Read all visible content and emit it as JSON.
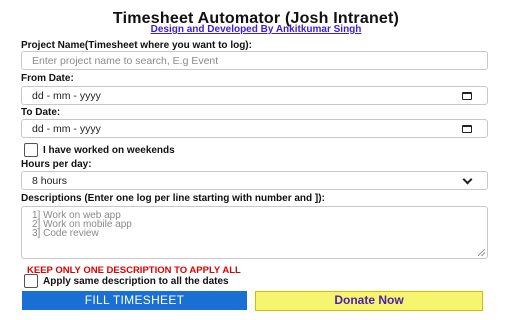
{
  "header": {
    "title": "Timesheet Automator (Josh Intranet)",
    "subtitle": "Design and Developed By Ankitkumar Singh"
  },
  "project": {
    "label": "Project Name(Timesheet where you want to log):",
    "placeholder": "Enter project name to search, E.g Event",
    "value": ""
  },
  "from_date": {
    "label": "From Date:",
    "placeholder": "dd - mm - yyyy",
    "icon": "calendar-icon"
  },
  "to_date": {
    "label": "To Date:",
    "placeholder": "dd - mm - yyyy",
    "icon": "calendar-icon"
  },
  "weekends": {
    "label": "I have worked on weekends",
    "checked": false
  },
  "hours": {
    "label": "Hours per day:",
    "selected": "8 hours",
    "icon": "chevron-down-icon"
  },
  "descriptions": {
    "label": "Descriptions (Enter one log per line starting with number and ]):",
    "placeholder_lines": [
      "1] Work on web app",
      "2] Work on mobile app",
      "3] Code review"
    ]
  },
  "warning": {
    "text": "KEEP ONLY ONE DESCRIPTION TO APPLY ALL",
    "color": "#e00000"
  },
  "apply_same": {
    "label": "Apply same description to all the dates",
    "checked": false
  },
  "buttons": {
    "fill_label": "FILL TIMESHEET",
    "fill_color": "#1a6fd4",
    "donate_label": "Donate Now",
    "donate_color": "#f5f56e"
  }
}
